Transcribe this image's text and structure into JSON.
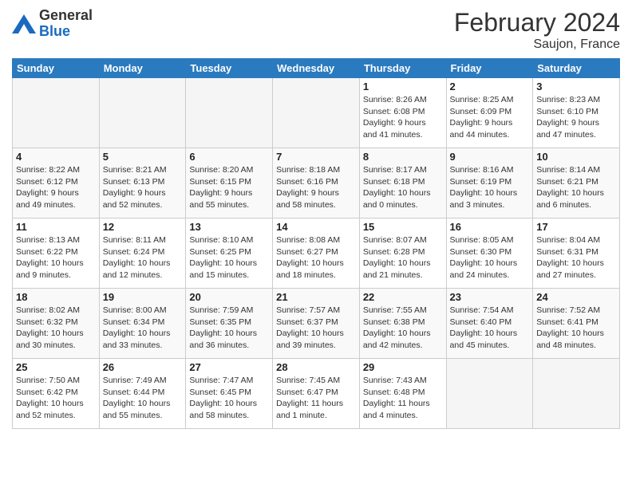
{
  "header": {
    "logo_general": "General",
    "logo_blue": "Blue",
    "month_year": "February 2024",
    "location": "Saujon, France"
  },
  "weekdays": [
    "Sunday",
    "Monday",
    "Tuesday",
    "Wednesday",
    "Thursday",
    "Friday",
    "Saturday"
  ],
  "weeks": [
    [
      {
        "day": "",
        "info": ""
      },
      {
        "day": "",
        "info": ""
      },
      {
        "day": "",
        "info": ""
      },
      {
        "day": "",
        "info": ""
      },
      {
        "day": "1",
        "info": "Sunrise: 8:26 AM\nSunset: 6:08 PM\nDaylight: 9 hours\nand 41 minutes."
      },
      {
        "day": "2",
        "info": "Sunrise: 8:25 AM\nSunset: 6:09 PM\nDaylight: 9 hours\nand 44 minutes."
      },
      {
        "day": "3",
        "info": "Sunrise: 8:23 AM\nSunset: 6:10 PM\nDaylight: 9 hours\nand 47 minutes."
      }
    ],
    [
      {
        "day": "4",
        "info": "Sunrise: 8:22 AM\nSunset: 6:12 PM\nDaylight: 9 hours\nand 49 minutes."
      },
      {
        "day": "5",
        "info": "Sunrise: 8:21 AM\nSunset: 6:13 PM\nDaylight: 9 hours\nand 52 minutes."
      },
      {
        "day": "6",
        "info": "Sunrise: 8:20 AM\nSunset: 6:15 PM\nDaylight: 9 hours\nand 55 minutes."
      },
      {
        "day": "7",
        "info": "Sunrise: 8:18 AM\nSunset: 6:16 PM\nDaylight: 9 hours\nand 58 minutes."
      },
      {
        "day": "8",
        "info": "Sunrise: 8:17 AM\nSunset: 6:18 PM\nDaylight: 10 hours\nand 0 minutes."
      },
      {
        "day": "9",
        "info": "Sunrise: 8:16 AM\nSunset: 6:19 PM\nDaylight: 10 hours\nand 3 minutes."
      },
      {
        "day": "10",
        "info": "Sunrise: 8:14 AM\nSunset: 6:21 PM\nDaylight: 10 hours\nand 6 minutes."
      }
    ],
    [
      {
        "day": "11",
        "info": "Sunrise: 8:13 AM\nSunset: 6:22 PM\nDaylight: 10 hours\nand 9 minutes."
      },
      {
        "day": "12",
        "info": "Sunrise: 8:11 AM\nSunset: 6:24 PM\nDaylight: 10 hours\nand 12 minutes."
      },
      {
        "day": "13",
        "info": "Sunrise: 8:10 AM\nSunset: 6:25 PM\nDaylight: 10 hours\nand 15 minutes."
      },
      {
        "day": "14",
        "info": "Sunrise: 8:08 AM\nSunset: 6:27 PM\nDaylight: 10 hours\nand 18 minutes."
      },
      {
        "day": "15",
        "info": "Sunrise: 8:07 AM\nSunset: 6:28 PM\nDaylight: 10 hours\nand 21 minutes."
      },
      {
        "day": "16",
        "info": "Sunrise: 8:05 AM\nSunset: 6:30 PM\nDaylight: 10 hours\nand 24 minutes."
      },
      {
        "day": "17",
        "info": "Sunrise: 8:04 AM\nSunset: 6:31 PM\nDaylight: 10 hours\nand 27 minutes."
      }
    ],
    [
      {
        "day": "18",
        "info": "Sunrise: 8:02 AM\nSunset: 6:32 PM\nDaylight: 10 hours\nand 30 minutes."
      },
      {
        "day": "19",
        "info": "Sunrise: 8:00 AM\nSunset: 6:34 PM\nDaylight: 10 hours\nand 33 minutes."
      },
      {
        "day": "20",
        "info": "Sunrise: 7:59 AM\nSunset: 6:35 PM\nDaylight: 10 hours\nand 36 minutes."
      },
      {
        "day": "21",
        "info": "Sunrise: 7:57 AM\nSunset: 6:37 PM\nDaylight: 10 hours\nand 39 minutes."
      },
      {
        "day": "22",
        "info": "Sunrise: 7:55 AM\nSunset: 6:38 PM\nDaylight: 10 hours\nand 42 minutes."
      },
      {
        "day": "23",
        "info": "Sunrise: 7:54 AM\nSunset: 6:40 PM\nDaylight: 10 hours\nand 45 minutes."
      },
      {
        "day": "24",
        "info": "Sunrise: 7:52 AM\nSunset: 6:41 PM\nDaylight: 10 hours\nand 48 minutes."
      }
    ],
    [
      {
        "day": "25",
        "info": "Sunrise: 7:50 AM\nSunset: 6:42 PM\nDaylight: 10 hours\nand 52 minutes."
      },
      {
        "day": "26",
        "info": "Sunrise: 7:49 AM\nSunset: 6:44 PM\nDaylight: 10 hours\nand 55 minutes."
      },
      {
        "day": "27",
        "info": "Sunrise: 7:47 AM\nSunset: 6:45 PM\nDaylight: 10 hours\nand 58 minutes."
      },
      {
        "day": "28",
        "info": "Sunrise: 7:45 AM\nSunset: 6:47 PM\nDaylight: 11 hours\nand 1 minute."
      },
      {
        "day": "29",
        "info": "Sunrise: 7:43 AM\nSunset: 6:48 PM\nDaylight: 11 hours\nand 4 minutes."
      },
      {
        "day": "",
        "info": ""
      },
      {
        "day": "",
        "info": ""
      }
    ]
  ]
}
